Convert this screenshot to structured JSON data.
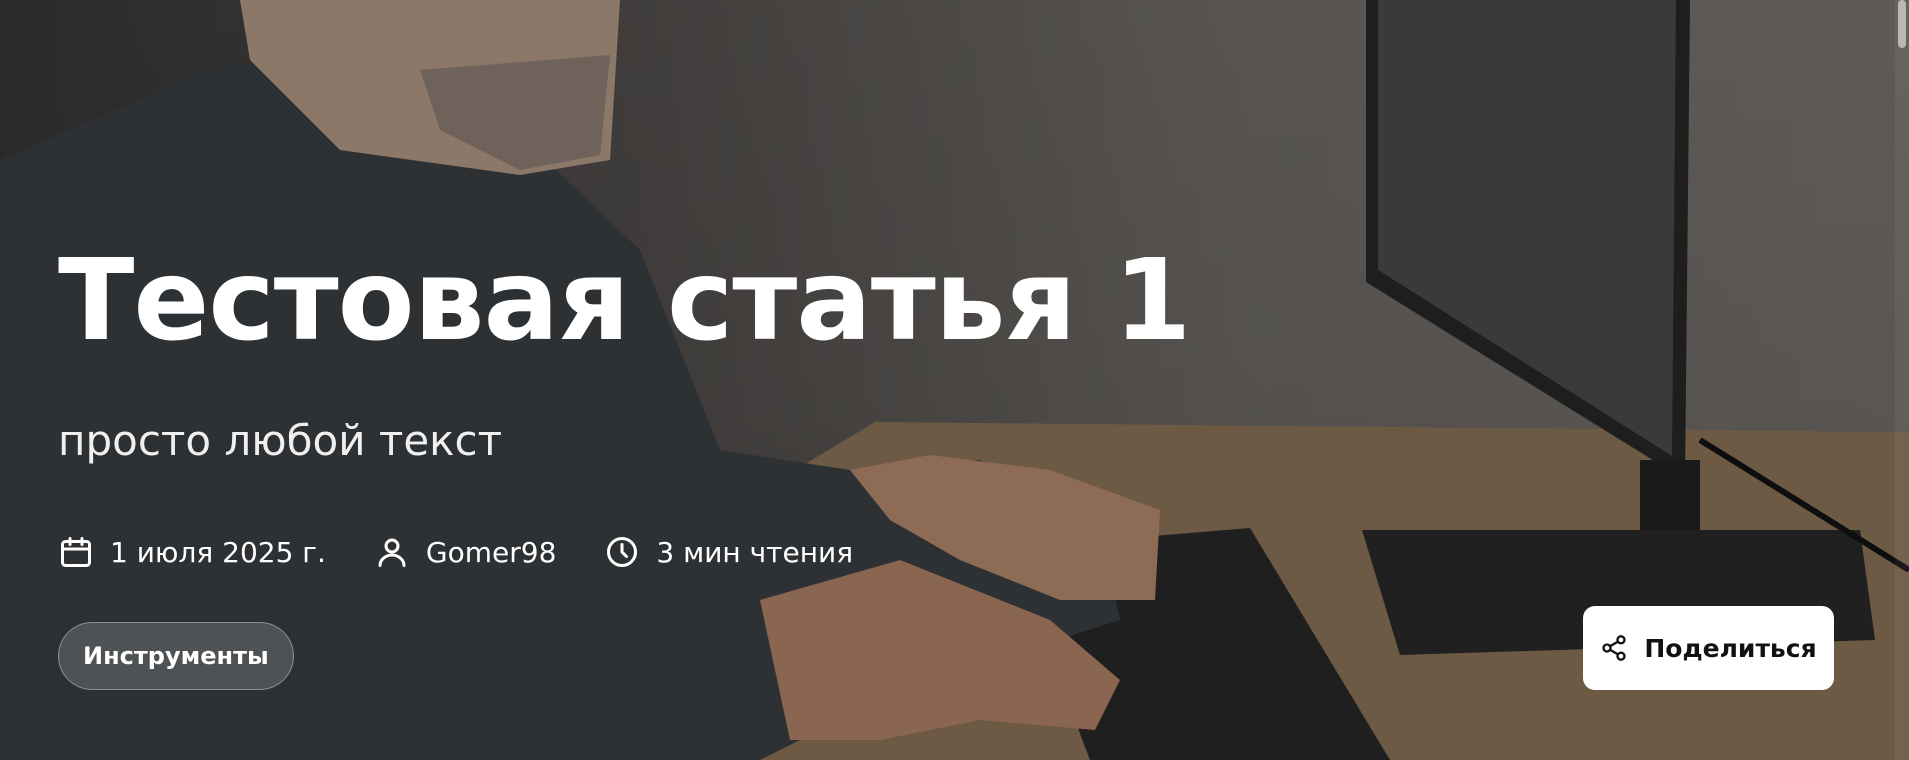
{
  "article": {
    "title": "Тестовая статья 1",
    "subtitle": "просто любой текст",
    "meta": {
      "date": "1 июля 2025 г.",
      "author": "Gomer98",
      "read_time": "3 мин чтения"
    },
    "tag": "Инструменты"
  },
  "share": {
    "label": "Поделиться"
  },
  "icons": {
    "date": "calendar-icon",
    "author": "user-icon",
    "read_time": "clock-icon",
    "share": "share-icon"
  }
}
